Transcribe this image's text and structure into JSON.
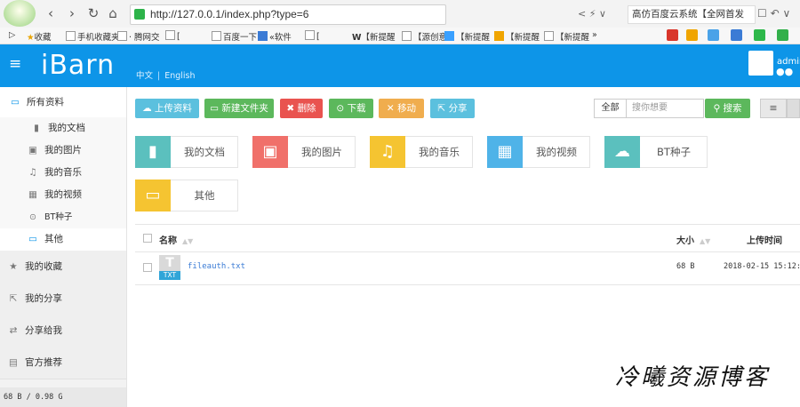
{
  "browser": {
    "url": "http://127.0.0.1/index.php?type=6",
    "search_engine_text": "高仿百度云系统【全网首发",
    "addr_tools": "< ⚡ ∨",
    "bookmarks": [
      "收藏",
      "手机收藏夹",
      "· 腾网交",
      "[",
      "百度一下",
      "«软件",
      "[",
      "【新提醒",
      "【源创意",
      "【新提醒",
      "【新提醒",
      "【新提醒",
      "»"
    ]
  },
  "app": {
    "logo": "iBarn",
    "lang_zh": "中文",
    "lang_en": "English",
    "user_name": "admin"
  },
  "sidebar": {
    "all_files": "所有资料",
    "sub_items": [
      {
        "label": "我的文档",
        "icon": "doc-icon"
      },
      {
        "label": "我的图片",
        "icon": "image-icon"
      },
      {
        "label": "我的音乐",
        "icon": "music-icon"
      },
      {
        "label": "我的视频",
        "icon": "video-icon"
      },
      {
        "label": "BT种子",
        "icon": "bt-icon"
      },
      {
        "label": "其他",
        "icon": "folder-icon"
      }
    ],
    "main_items": [
      {
        "label": "我的收藏",
        "icon": "star-icon"
      },
      {
        "label": "我的分享",
        "icon": "share-icon"
      },
      {
        "label": "分享给我",
        "icon": "retweet-icon"
      },
      {
        "label": "官方推荐",
        "icon": "gift-icon"
      }
    ],
    "storage": "68 B / 0.98 G"
  },
  "toolbar": {
    "upload": "上传资料",
    "new_folder": "新建文件夹",
    "delete": "删除",
    "download": "下载",
    "move": "移动",
    "share": "分享",
    "search_scope": "全部",
    "search_placeholder": "搜你想要",
    "search_button": "搜索"
  },
  "categories": [
    {
      "label": "我的文档",
      "color": "#5bc0be"
    },
    {
      "label": "我的图片",
      "color": "#f0706a"
    },
    {
      "label": "我的音乐",
      "color": "#f5c431"
    },
    {
      "label": "我的视频",
      "color": "#4fb3e8"
    },
    {
      "label": "BT种子",
      "color": "#5bc0be"
    },
    {
      "label": "其他",
      "color": "#f5c431"
    }
  ],
  "table": {
    "col_name": "名称",
    "col_size": "大小",
    "col_time": "上传时间",
    "rows": [
      {
        "icon_letter": "T",
        "ext": "TXT",
        "name": "fileauth.txt",
        "size": "68 B",
        "time": "2018-02-15 15:12:2"
      }
    ]
  },
  "watermark": "冷曦资源博客",
  "colors": {
    "header": "#0d95e8",
    "upload": "#5bc0de",
    "new_folder": "#5cb85c",
    "delete": "#e9534f",
    "download": "#5cb85c",
    "move": "#f0ad4e",
    "share": "#5bc0de"
  }
}
